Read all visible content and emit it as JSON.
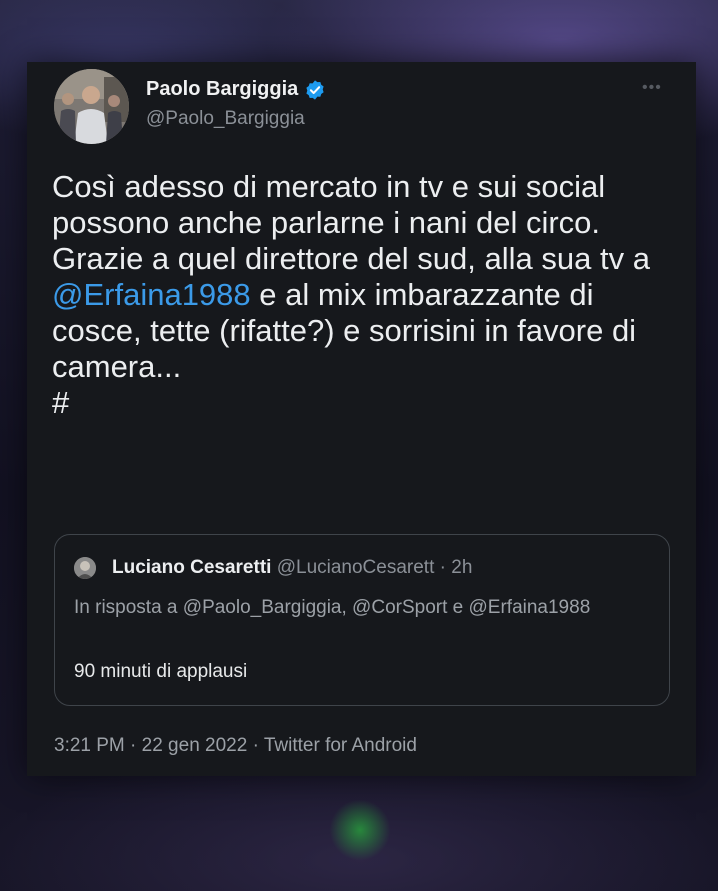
{
  "tweet": {
    "author": {
      "name": "Paolo Bargiggia",
      "handle": "@Paolo_Bargiggia",
      "verified": true
    },
    "more_icon": "more-horizontal-icon",
    "text_before_mention": "Così adesso di mercato in tv e sui social possono anche parlarne i nani del circo. Grazie a quel direttore del sud, alla sua tv a ",
    "mention": "@Erfaina1988",
    "text_after_mention": " e al mix imbarazzante di cosce, tette (rifatte?) e sorrisini in favore di camera...",
    "hashtag": "#",
    "timestamp": "3:21 PM · 22 gen 2022 · Twitter for Android"
  },
  "quoted_tweet": {
    "name": "Luciano Cesaretti",
    "handle_time": "@LucianoCesarett · 2h",
    "in_reply_to": "In risposta a @Paolo_Bargiggia, @CorSport e @Erfaina1988",
    "text": "90 minuti di applausi"
  },
  "colors": {
    "card_background": "#16181c",
    "mention": "#3b9ae8",
    "verified_badge": "#1d9bf0",
    "secondary_text": "#8b9097"
  }
}
